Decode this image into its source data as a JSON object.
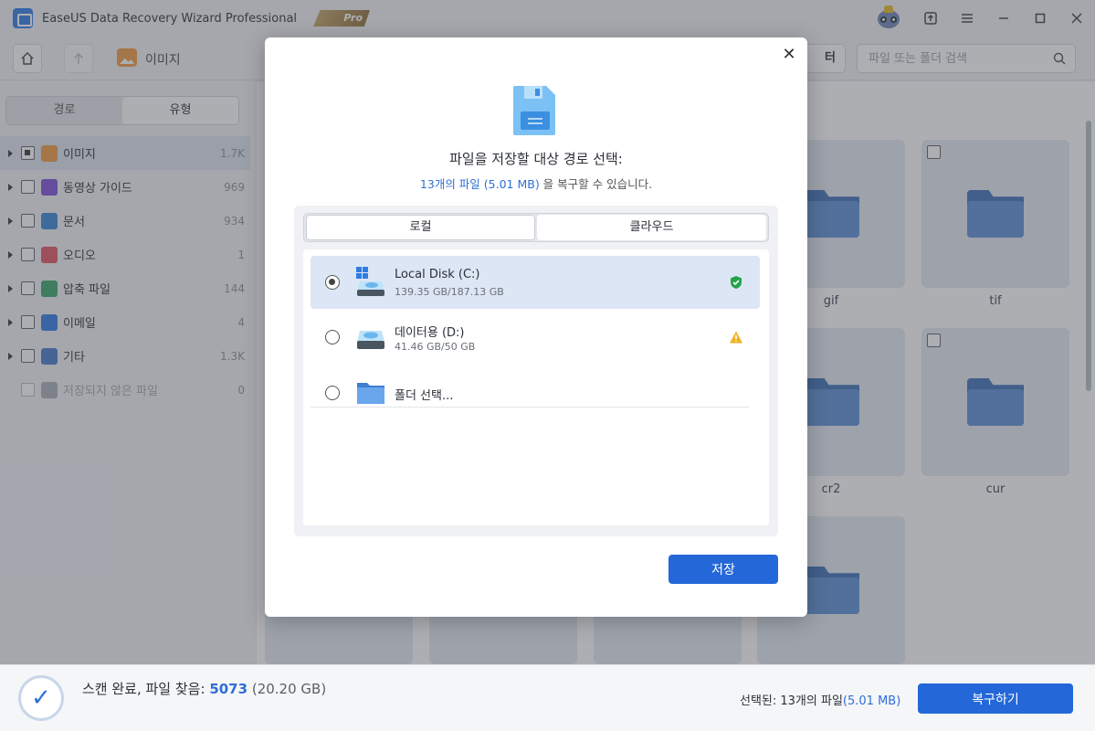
{
  "app": {
    "title": "EaseUS Data Recovery Wizard Professional",
    "badge": "Pro"
  },
  "toolbar": {
    "breadcrumb": "이미지",
    "filter_label": "터",
    "search_placeholder": "파일 또는 폴더 검색"
  },
  "sidebar": {
    "segments": [
      "경로",
      "유형"
    ],
    "active_segment": "유형",
    "items": [
      {
        "label": "이미지",
        "count": "1.7K",
        "icon": "image-icon",
        "color": "#f39a3c"
      },
      {
        "label": "동영상 가이드",
        "count": "969",
        "icon": "video-icon",
        "color": "#7c4fd8"
      },
      {
        "label": "문서",
        "count": "934",
        "icon": "document-icon",
        "color": "#3a86d6"
      },
      {
        "label": "오디오",
        "count": "1",
        "icon": "audio-icon",
        "color": "#e25563"
      },
      {
        "label": "압축 파일",
        "count": "144",
        "icon": "archive-icon",
        "color": "#3aa56b"
      },
      {
        "label": "이메일",
        "count": "4",
        "icon": "email-icon",
        "color": "#2f7be5"
      },
      {
        "label": "기타",
        "count": "1.3K",
        "icon": "other-icon",
        "color": "#4a78c9"
      },
      {
        "label": "저장되지 않은 파일",
        "count": "0",
        "icon": "unsaved-file-icon",
        "color": "#a9adb4"
      }
    ]
  },
  "grid": {
    "labels": [
      "gif",
      "tif",
      "cr2",
      "cur"
    ]
  },
  "bottom": {
    "scan_prefix": "스캔 완료, 파일 찾음:",
    "scan_count": "5073",
    "scan_size": "(20.20 GB)",
    "selected_prefix": "선택된: 13개의 파일",
    "selected_size": "(5.01 MB)",
    "recover_label": "복구하기"
  },
  "modal": {
    "title": "파일을 저장할 대상 경로 선택:",
    "subtitle_highlight": "13개의 파일 (5.01 MB)",
    "subtitle_rest": " 을 복구할 수 있습니다.",
    "tabs": [
      "로컬",
      "클라우드"
    ],
    "destinations": [
      {
        "name": "Local Disk (C:)",
        "size": "139.35 GB/187.13 GB",
        "status": "safe-shield-icon",
        "status_color": "#22a447"
      },
      {
        "name": "데이터용 (D:)",
        "size": "41.46 GB/50 GB",
        "status": "warning-icon",
        "status_color": "#f0b323"
      },
      {
        "name": "폴더 선택..."
      }
    ],
    "save_label": "저장"
  }
}
